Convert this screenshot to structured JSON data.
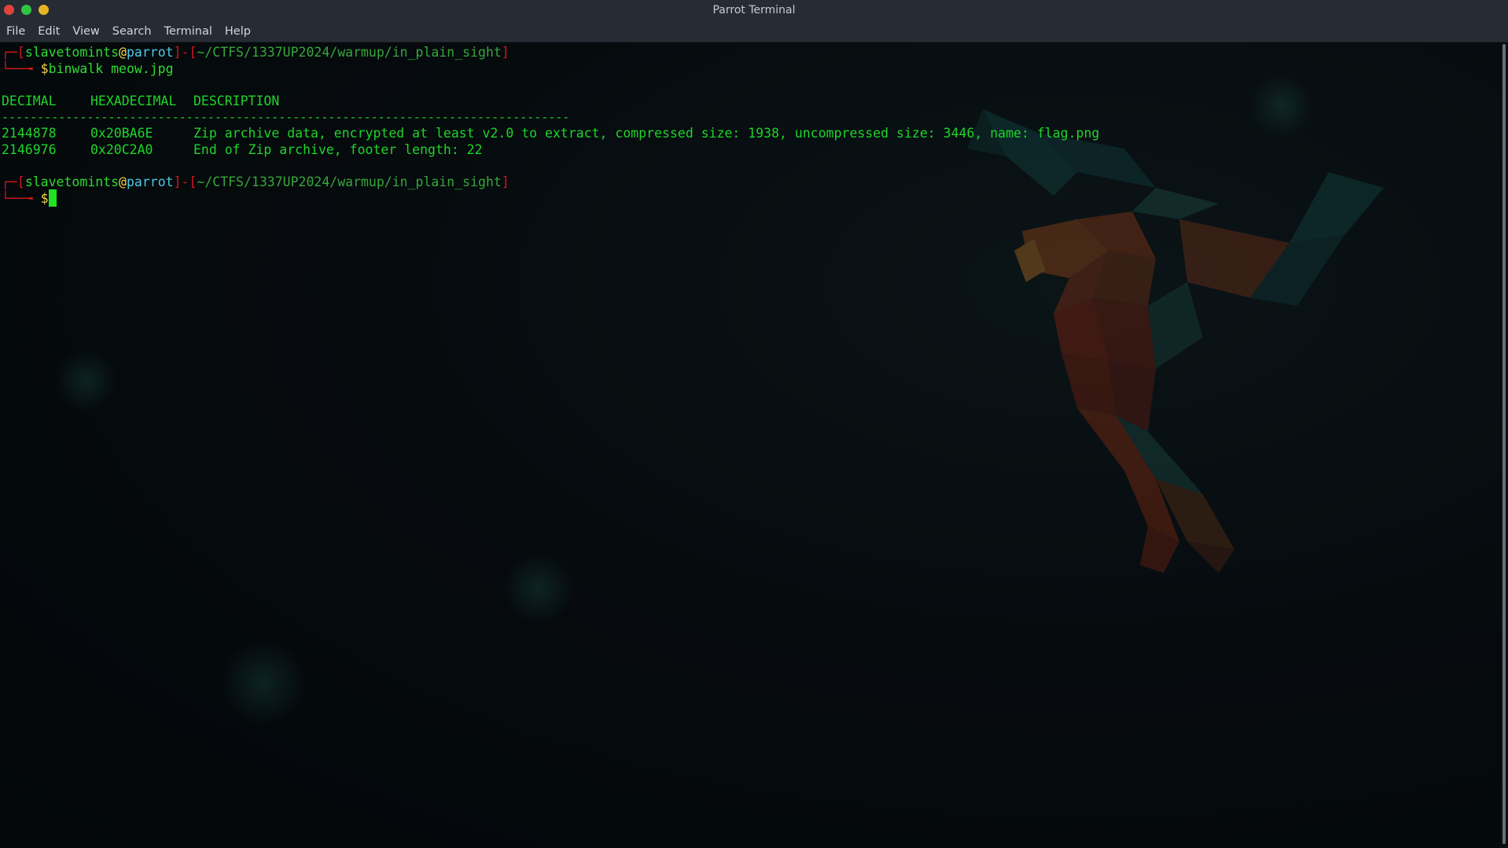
{
  "window": {
    "title": "Parrot Terminal",
    "controls": {
      "close_color": "#e0443e",
      "maximize_color": "#30c541",
      "minimize_color": "#e6b325"
    }
  },
  "menu": {
    "items": [
      "File",
      "Edit",
      "View",
      "Search",
      "Terminal",
      "Help"
    ]
  },
  "terminal": {
    "prompt1": {
      "user": "slavetomints",
      "at": "@",
      "host": "parrot",
      "dash": "-",
      "path": "~/CTFS/1337UP2024/warmup/in_plain_sight",
      "dollar": "$",
      "command": "binwalk meow.jpg"
    },
    "output": {
      "header_decimal": "DECIMAL",
      "header_hex": "HEXADECIMAL",
      "header_desc": "DESCRIPTION",
      "separator": "--------------------------------------------------------------------------------",
      "rows": [
        {
          "decimal": "2144878",
          "hex": "0x20BA6E",
          "desc": "Zip archive data, encrypted at least v2.0 to extract, compressed size: 1938, uncompressed size: 3446, name: flag.png"
        },
        {
          "decimal": "2146976",
          "hex": "0x20C2A0",
          "desc": "End of Zip archive, footer length: 22"
        }
      ]
    },
    "prompt2": {
      "user": "slavetomints",
      "at": "@",
      "host": "parrot",
      "dash": "-",
      "path": "~/CTFS/1337UP2024/warmup/in_plain_sight",
      "dollar": "$",
      "command": ""
    }
  },
  "colors": {
    "prompt_bracket": "#d4181b",
    "user": "#2cdc2e",
    "host": "#4ec9e6",
    "path": "#37a63a",
    "output": "#1fd42a"
  }
}
